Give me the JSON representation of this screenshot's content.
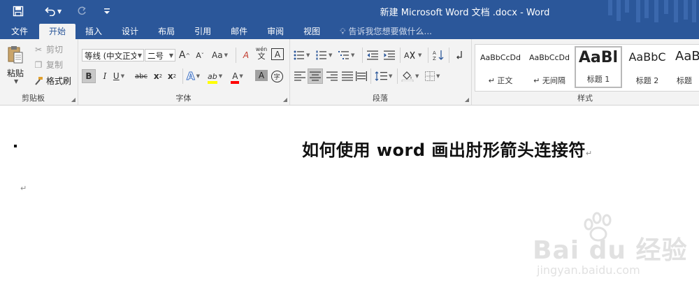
{
  "window": {
    "title": "新建 Microsoft Word 文档 .docx - Word",
    "accent": "#2b579a"
  },
  "qat": {
    "save_icon": "save-icon",
    "undo_icon": "undo-icon",
    "redo_icon": "redo-icon",
    "customize_icon": "customize-qat-icon"
  },
  "tabs": [
    {
      "label": "文件"
    },
    {
      "label": "开始"
    },
    {
      "label": "插入"
    },
    {
      "label": "设计"
    },
    {
      "label": "布局"
    },
    {
      "label": "引用"
    },
    {
      "label": "邮件"
    },
    {
      "label": "审阅"
    },
    {
      "label": "视图"
    }
  ],
  "tell_me": {
    "placeholder": "告诉我您想要做什么..."
  },
  "clipboard": {
    "paste": "粘贴",
    "cut": "剪切",
    "copy": "复制",
    "format_painter": "格式刷",
    "label": "剪贴板"
  },
  "font": {
    "font_name": "等线 (中文正文)",
    "font_size": "二号",
    "grow": "A",
    "shrink": "A",
    "change_case": "Aa",
    "clear_format": "A",
    "phonetic_top": "wén",
    "phonetic_bottom": "文",
    "char_border": "A",
    "bold": "B",
    "italic": "I",
    "underline": "U",
    "strike": "abc",
    "subscript": "x",
    "superscript": "x",
    "sub_mark": "2",
    "sup_mark": "2",
    "effects": "A",
    "highlight": "ab",
    "font_color": "A",
    "char_shading": "A",
    "enclose": "字",
    "label": "字体",
    "highlight_color": "#ffff00",
    "font_color_value": "#ff0000"
  },
  "paragraph": {
    "label": "段落"
  },
  "styles": {
    "label": "样式",
    "items": [
      {
        "preview": "AaBbCcDd",
        "name": "↵ 正文"
      },
      {
        "preview": "AaBbCcDd",
        "name": "↵ 无间隔"
      },
      {
        "preview": "AaBl",
        "name": "标题 1"
      },
      {
        "preview": "AaBbC",
        "name": "标题 2"
      },
      {
        "preview": "AaBl",
        "name": "标题"
      }
    ]
  },
  "document": {
    "heading": "如何使用 word 画出肘形箭头连接符",
    "paragraph_mark": "↵"
  },
  "watermark": {
    "text": "Bai du 经验",
    "url": "jingyan.baidu.com"
  }
}
